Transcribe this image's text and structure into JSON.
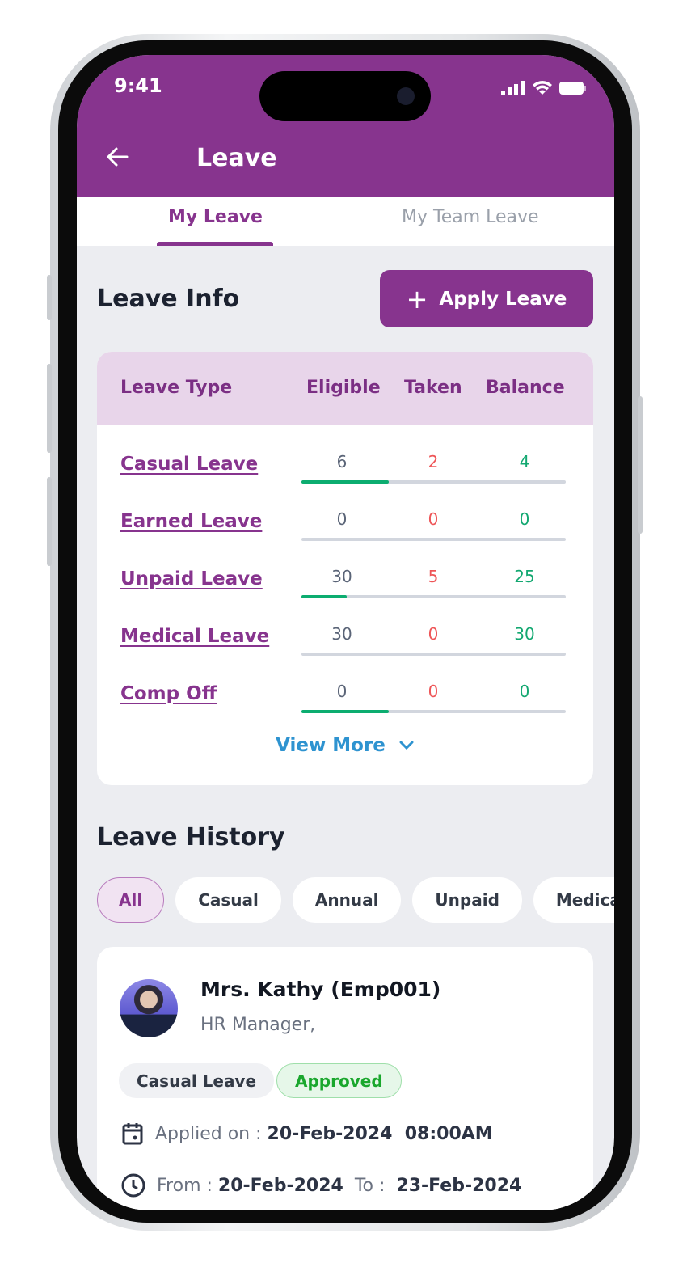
{
  "status_bar": {
    "time": "9:41"
  },
  "header": {
    "title": "Leave",
    "back_icon": "arrow-left-icon"
  },
  "tabs": [
    {
      "label": "My Leave",
      "active": true
    },
    {
      "label": "My Team Leave",
      "active": false
    }
  ],
  "leave_info": {
    "title": "Leave Info",
    "apply_button": "Apply Leave",
    "columns": [
      "Leave Type",
      "Eligible",
      "Taken",
      "Balance"
    ],
    "rows": [
      {
        "type": "Casual Leave",
        "eligible": "6",
        "taken": "2",
        "balance": "4",
        "progress": 0.33
      },
      {
        "type": "Earned Leave",
        "eligible": "0",
        "taken": "0",
        "balance": "0",
        "progress": 0
      },
      {
        "type": "Unpaid Leave",
        "eligible": "30",
        "taken": "5",
        "balance": "25",
        "progress": 0.17
      },
      {
        "type": "Medical Leave",
        "eligible": "30",
        "taken": "0",
        "balance": "30",
        "progress": 0
      },
      {
        "type": "Comp Off",
        "eligible": "0",
        "taken": "0",
        "balance": "0",
        "progress": 0.33
      }
    ],
    "view_more": "View More"
  },
  "leave_history": {
    "title": "Leave History",
    "filters": [
      "All",
      "Casual",
      "Annual",
      "Unpaid",
      "Medical"
    ],
    "entry": {
      "name": "Mrs. Kathy (Emp001)",
      "role": "HR Manager,",
      "leave_type": "Casual Leave",
      "status": "Approved",
      "applied_label": "Applied on :",
      "applied_value": "20-Feb-2024  08:00AM",
      "from_label": "From :",
      "from_value": "20-Feb-2024",
      "to_label": "To :",
      "to_value": "23-Feb-2024"
    }
  },
  "colors": {
    "primary": "#87348e",
    "taken": "#ee5557",
    "balance": "#13a871",
    "link": "#2e93d0",
    "approved": "#1aa72d"
  }
}
